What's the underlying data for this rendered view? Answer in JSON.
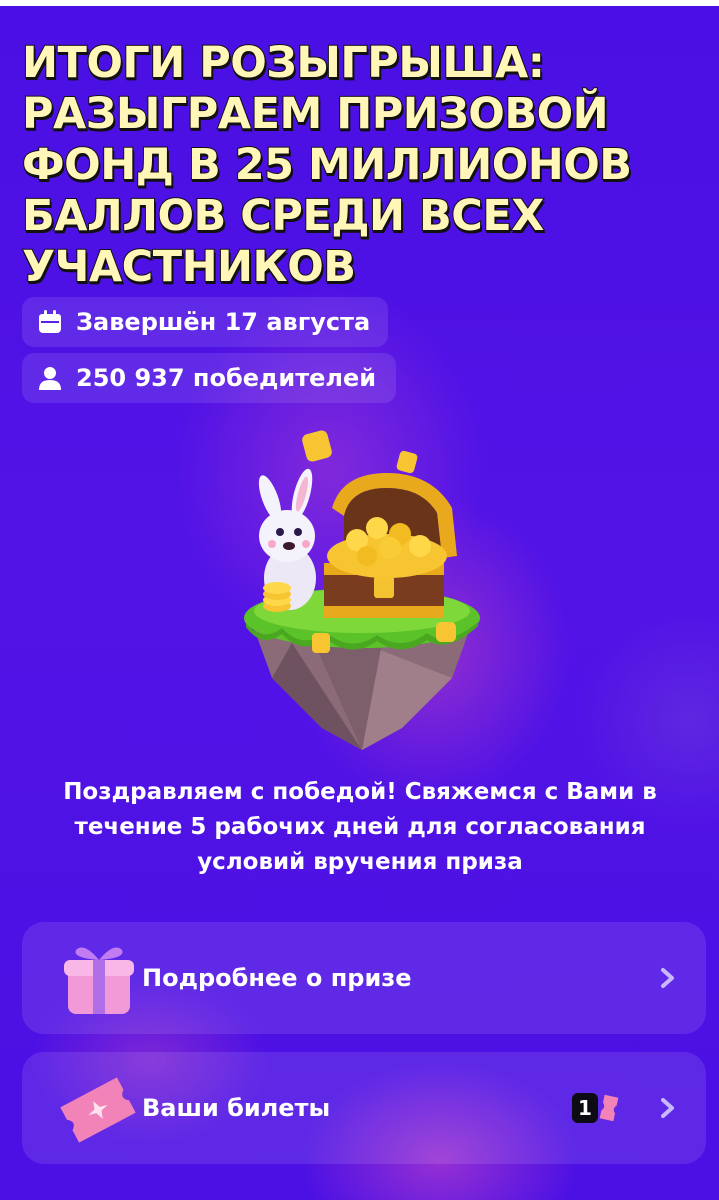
{
  "header": {
    "title": "ИТОГИ РОЗЫГРЫША: РАЗЫГРАЕМ ПРИЗОВОЙ ФОНД В 25 МИЛЛИОНОВ БАЛЛОВ СРЕДИ ВСЕХ УЧАСТНИКОВ"
  },
  "meta": {
    "end_icon": "calendar-icon",
    "end_text": "Завершён 17 августа",
    "winners_icon": "user-icon",
    "winners_text": "250 937 победителей"
  },
  "hero": {
    "image": "bunny-with-treasure-chest-illustration"
  },
  "message": {
    "text": "Поздравляем с победой! Свяжемся с Вами в течение 5 рабочих дней для согласования условий вручения приза"
  },
  "cards": [
    {
      "label": "Подробнее о призе",
      "icon": "gift-icon"
    },
    {
      "label": "Ваши билеты",
      "icon": "ticket-icon",
      "count": "1"
    }
  ],
  "colors": {
    "background": "#4a12e6",
    "title_fill": "#fff6b8",
    "card_bg": "rgba(255,255,255,0.10)"
  }
}
